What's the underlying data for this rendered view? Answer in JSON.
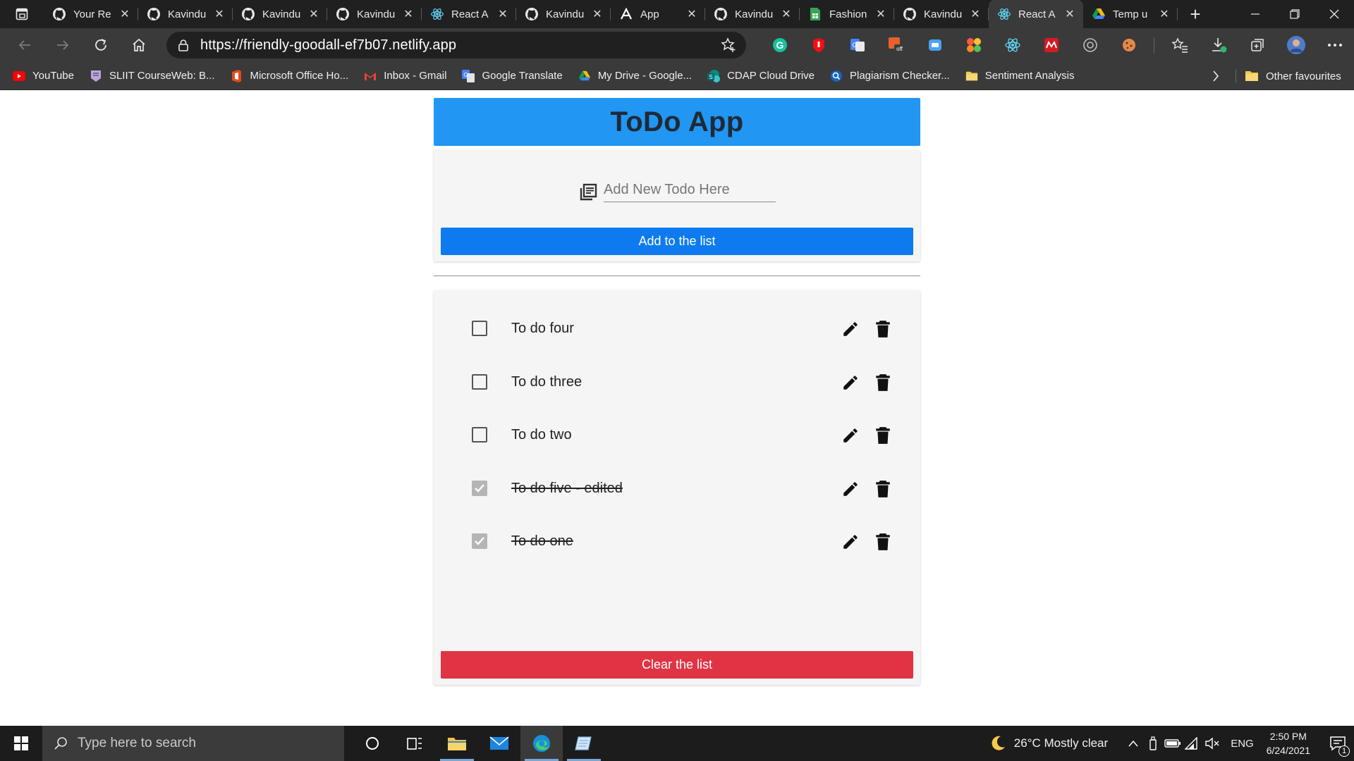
{
  "browser": {
    "tabs": [
      {
        "label": "Your Re",
        "icon": "github-icon",
        "active": false
      },
      {
        "label": "Kavindu",
        "icon": "github-icon",
        "active": false
      },
      {
        "label": "Kavindu",
        "icon": "github-icon",
        "active": false
      },
      {
        "label": "Kavindu",
        "icon": "github-icon",
        "active": false
      },
      {
        "label": "React A",
        "icon": "react-icon",
        "active": false
      },
      {
        "label": "Kavindu",
        "icon": "github-icon",
        "active": false
      },
      {
        "label": "App",
        "icon": "app-a-icon",
        "active": false
      },
      {
        "label": "Kavindu",
        "icon": "github-icon",
        "active": false
      },
      {
        "label": "Fashion",
        "icon": "sheets-icon",
        "active": false
      },
      {
        "label": "Kavindu",
        "icon": "github-icon",
        "active": false
      },
      {
        "label": "React A",
        "icon": "react-icon",
        "active": true
      },
      {
        "label": "Temp u",
        "icon": "drive-icon",
        "active": false
      }
    ],
    "url": "https://friendly-goodall-ef7b07.netlify.app",
    "bookmarks": [
      {
        "label": "YouTube",
        "icon": "youtube-icon",
        "color": "#ff0000"
      },
      {
        "label": "SLIIT CourseWeb: B...",
        "icon": "sliit-icon",
        "color": "#b8a7d8"
      },
      {
        "label": "Microsoft Office Ho...",
        "icon": "office-icon",
        "color": "#e64a19"
      },
      {
        "label": "Inbox - Gmail",
        "icon": "gmail-icon",
        "color": "#ea4335"
      },
      {
        "label": "Google Translate",
        "icon": "translate-icon",
        "color": "#4285f4"
      },
      {
        "label": "My Drive - Google...",
        "icon": "drive-icon",
        "color": "#fbbc04"
      },
      {
        "label": "CDAP Cloud Drive",
        "icon": "sharepoint-icon",
        "color": "#0b8a7a"
      },
      {
        "label": "Plagiarism Checker...",
        "icon": "plagiarism-icon",
        "color": "#1565c0"
      },
      {
        "label": "Sentiment Analysis",
        "icon": "folder-icon",
        "color": "#f2c94c"
      }
    ],
    "other_favourites": "Other favourites"
  },
  "app": {
    "title": "ToDo App",
    "input_placeholder": "Add New Todo Here",
    "add_button": "Add to the list",
    "clear_button": "Clear the list",
    "todos": [
      {
        "text": "To do four",
        "done": false
      },
      {
        "text": "To do three",
        "done": false
      },
      {
        "text": "To do two",
        "done": false
      },
      {
        "text": "To do five - edited",
        "done": true
      },
      {
        "text": "To do one",
        "done": true
      }
    ],
    "header_color": "#2196f3",
    "add_color": "#0d7bef",
    "clear_color": "#e03444"
  },
  "taskbar": {
    "search_placeholder": "Type here to search",
    "weather": "26°C  Mostly clear",
    "language": "ENG",
    "time": "2:50 PM",
    "date": "6/24/2021",
    "notification_count": "1"
  }
}
